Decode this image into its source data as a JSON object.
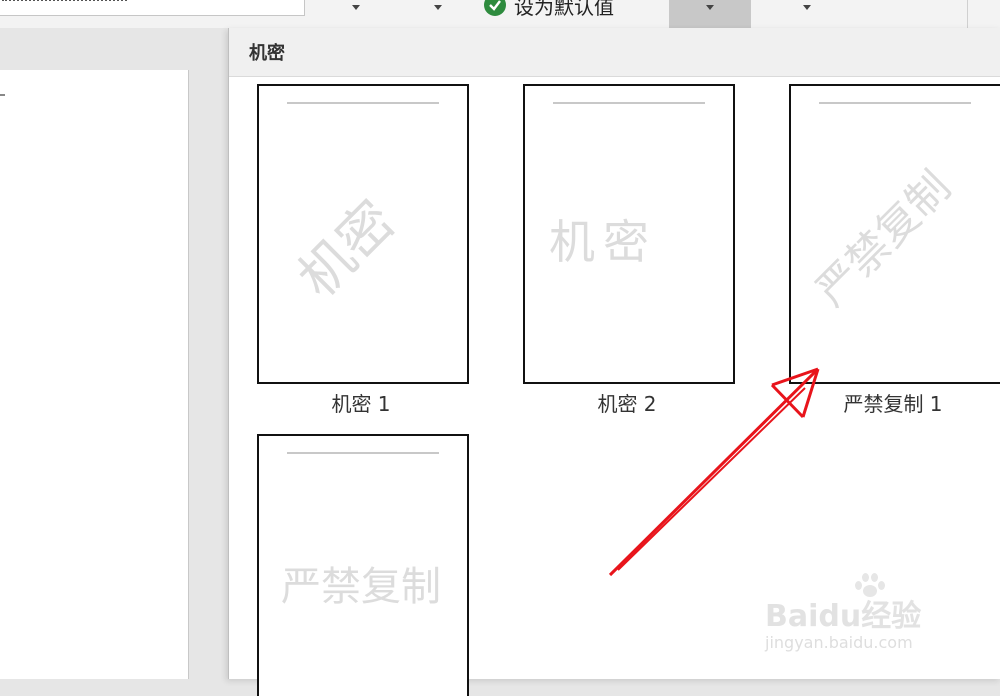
{
  "toolbar": {
    "set_default_label": "设为默认值"
  },
  "gallery": {
    "category_title": "机密",
    "items": [
      {
        "caption": "机密 1",
        "watermark_text": "机密",
        "orientation": "diagonal"
      },
      {
        "caption": "机密 2",
        "watermark_text": "机密",
        "orientation": "horizontal"
      },
      {
        "caption": "严禁复制 1",
        "watermark_text": "严禁复制",
        "orientation": "diagonal"
      },
      {
        "caption": "",
        "watermark_text": "严禁复制",
        "orientation": "horizontal"
      }
    ]
  },
  "watermark": {
    "brand": "Baidu经验",
    "url": "jingyan.baidu.com"
  },
  "colors": {
    "accent_check": "#2e8b3e",
    "annotation_arrow": "#e8141b",
    "panel_header_bg": "#f0f0f0"
  }
}
